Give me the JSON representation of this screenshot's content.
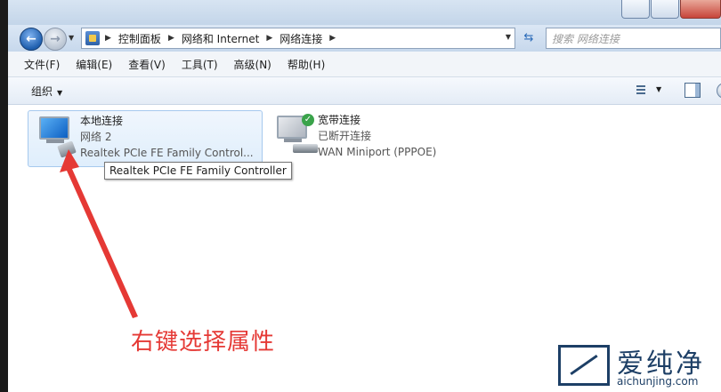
{
  "address": {
    "crumbs": [
      "控制面板",
      "网络和 Internet",
      "网络连接"
    ],
    "search_placeholder": "搜索 网络连接"
  },
  "menu": [
    "文件(F)",
    "编辑(E)",
    "查看(V)",
    "工具(T)",
    "高级(N)",
    "帮助(H)"
  ],
  "toolbar": {
    "organize_label": "组织"
  },
  "connections": [
    {
      "name": "本地连接",
      "network": "网络  2",
      "adapter": "Realtek PCIe FE Family Control...",
      "selected": true
    },
    {
      "name": "宽带连接",
      "network": "已断开连接",
      "adapter": "WAN Miniport (PPPOE)",
      "selected": false
    }
  ],
  "tooltip": "Realtek PCIe FE Family Controller",
  "annotation": "右键选择属性",
  "annotation_color": "#e53935",
  "watermark": {
    "title": "爱纯净",
    "url": "aichunjing.com"
  },
  "icons": [
    "back-arrow-icon",
    "forward-arrow-icon",
    "control-panel-icon",
    "refresh-icon",
    "search-icon",
    "view-options-icon",
    "preview-pane-icon",
    "help-icon",
    "network-connection-icon",
    "connected-check-icon",
    "annotation-arrow-icon"
  ]
}
